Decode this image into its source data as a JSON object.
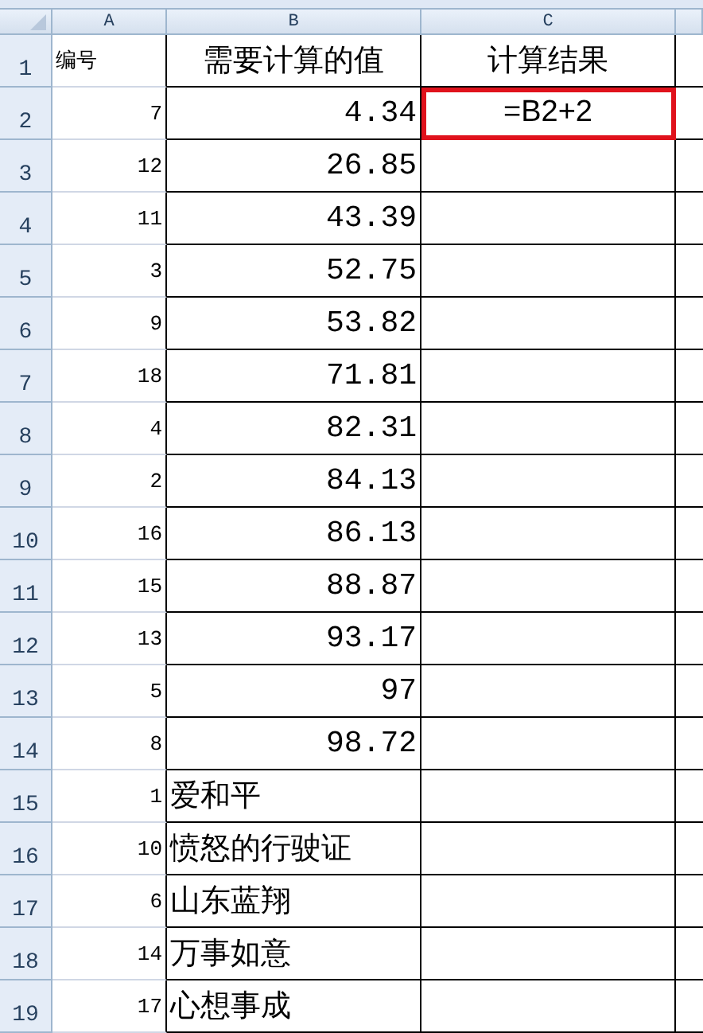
{
  "columns": [
    "A",
    "B",
    "C"
  ],
  "rows": [
    {
      "number": "1",
      "kind": "header",
      "cells": [
        {
          "text": "编号",
          "selected": false
        },
        {
          "text": "需要计算的值",
          "selected": false
        },
        {
          "text": "计算结果",
          "selected": false
        }
      ]
    },
    {
      "number": "2",
      "kind": "number",
      "cells": [
        {
          "text": "7",
          "selected": false
        },
        {
          "text": "4.34",
          "selected": false
        },
        {
          "text": "=B2+2",
          "selected": true
        }
      ]
    },
    {
      "number": "3",
      "kind": "number",
      "cells": [
        {
          "text": "12",
          "selected": false
        },
        {
          "text": "26.85",
          "selected": false
        },
        {
          "selected": false
        }
      ]
    },
    {
      "number": "4",
      "kind": "number",
      "cells": [
        {
          "text": "11",
          "selected": false
        },
        {
          "text": "43.39",
          "selected": false
        },
        {
          "selected": false
        }
      ]
    },
    {
      "number": "5",
      "kind": "number",
      "cells": [
        {
          "text": "3",
          "selected": false
        },
        {
          "text": "52.75",
          "selected": false
        },
        {
          "selected": false
        }
      ]
    },
    {
      "number": "6",
      "kind": "number",
      "cells": [
        {
          "text": "9",
          "selected": false
        },
        {
          "text": "53.82",
          "selected": false
        },
        {
          "selected": false
        }
      ]
    },
    {
      "number": "7",
      "kind": "number",
      "cells": [
        {
          "text": "18",
          "selected": false
        },
        {
          "text": "71.81",
          "selected": false
        },
        {
          "selected": false
        }
      ]
    },
    {
      "number": "8",
      "kind": "number",
      "cells": [
        {
          "text": "4",
          "selected": false
        },
        {
          "text": "82.31",
          "selected": false
        },
        {
          "selected": false
        }
      ]
    },
    {
      "number": "9",
      "kind": "number",
      "cells": [
        {
          "text": "2",
          "selected": false
        },
        {
          "text": "84.13",
          "selected": false
        },
        {
          "selected": false
        }
      ]
    },
    {
      "number": "10",
      "kind": "number",
      "cells": [
        {
          "text": "16",
          "selected": false
        },
        {
          "text": "86.13",
          "selected": false
        },
        {
          "selected": false
        }
      ]
    },
    {
      "number": "11",
      "kind": "number",
      "cells": [
        {
          "text": "15",
          "selected": false
        },
        {
          "text": "88.87",
          "selected": false
        },
        {
          "selected": false
        }
      ]
    },
    {
      "number": "12",
      "kind": "number",
      "cells": [
        {
          "text": "13",
          "selected": false
        },
        {
          "text": "93.17",
          "selected": false
        },
        {
          "selected": false
        }
      ]
    },
    {
      "number": "13",
      "kind": "number",
      "cells": [
        {
          "text": "5",
          "selected": false
        },
        {
          "text": "97",
          "selected": false
        },
        {
          "selected": false
        }
      ]
    },
    {
      "number": "14",
      "kind": "number",
      "cells": [
        {
          "text": "8",
          "selected": false
        },
        {
          "text": "98.72",
          "selected": false
        },
        {
          "selected": false
        }
      ]
    },
    {
      "number": "15",
      "kind": "text",
      "cells": [
        {
          "text": "1",
          "selected": false
        },
        {
          "text": "爱和平",
          "selected": false
        },
        {
          "selected": false
        }
      ]
    },
    {
      "number": "16",
      "kind": "text",
      "cells": [
        {
          "text": "10",
          "selected": false
        },
        {
          "text": "愤怒的行驶证",
          "selected": false
        },
        {
          "selected": false
        }
      ]
    },
    {
      "number": "17",
      "kind": "text",
      "cells": [
        {
          "text": "6",
          "selected": false
        },
        {
          "text": "山东蓝翔",
          "selected": false
        },
        {
          "selected": false
        }
      ]
    },
    {
      "number": "18",
      "kind": "text",
      "cells": [
        {
          "text": "14",
          "selected": false
        },
        {
          "text": "万事如意",
          "selected": false
        },
        {
          "selected": false
        }
      ]
    },
    {
      "number": "19",
      "kind": "text",
      "cells": [
        {
          "text": "17",
          "selected": false
        },
        {
          "text": "心想事成",
          "selected": false
        },
        {
          "selected": false
        }
      ]
    }
  ]
}
